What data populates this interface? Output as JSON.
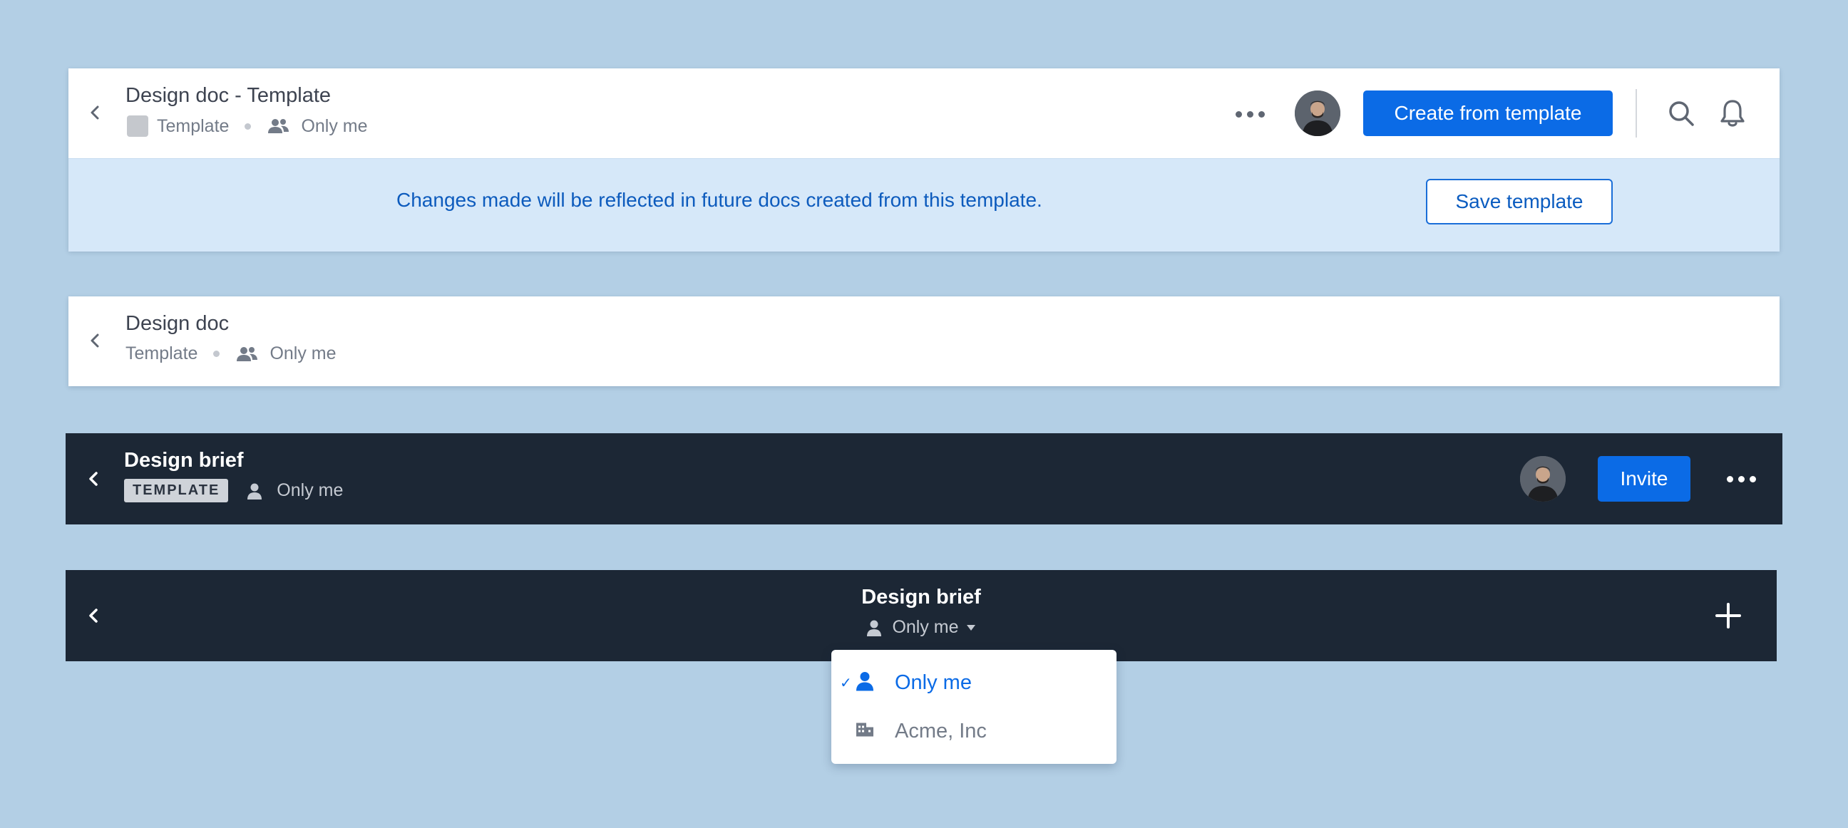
{
  "header1": {
    "title": "Design doc - Template",
    "meta_type": "Template",
    "meta_sharing": "Only me",
    "primary_button": "Create from template",
    "banner_text": "Changes made will be reflected in future docs created from this template.",
    "save_button": "Save template"
  },
  "header2": {
    "title": "Design doc",
    "meta_type": "Template",
    "meta_sharing": "Only me"
  },
  "header3": {
    "title": "Design brief",
    "badge": "TEMPLATE",
    "meta_sharing": "Only me",
    "invite_button": "Invite"
  },
  "header4": {
    "title": "Design brief",
    "sharing_select": "Only me"
  },
  "dropdown": {
    "items": [
      {
        "label": "Only me",
        "selected": true,
        "icon": "person-icon"
      },
      {
        "label": "Acme, Inc",
        "selected": false,
        "icon": "building-icon"
      }
    ]
  },
  "colors": {
    "background": "#b3cfe5",
    "accent": "#0b6be6",
    "dark_header": "#1c2735",
    "banner": "#d6e8f9"
  }
}
